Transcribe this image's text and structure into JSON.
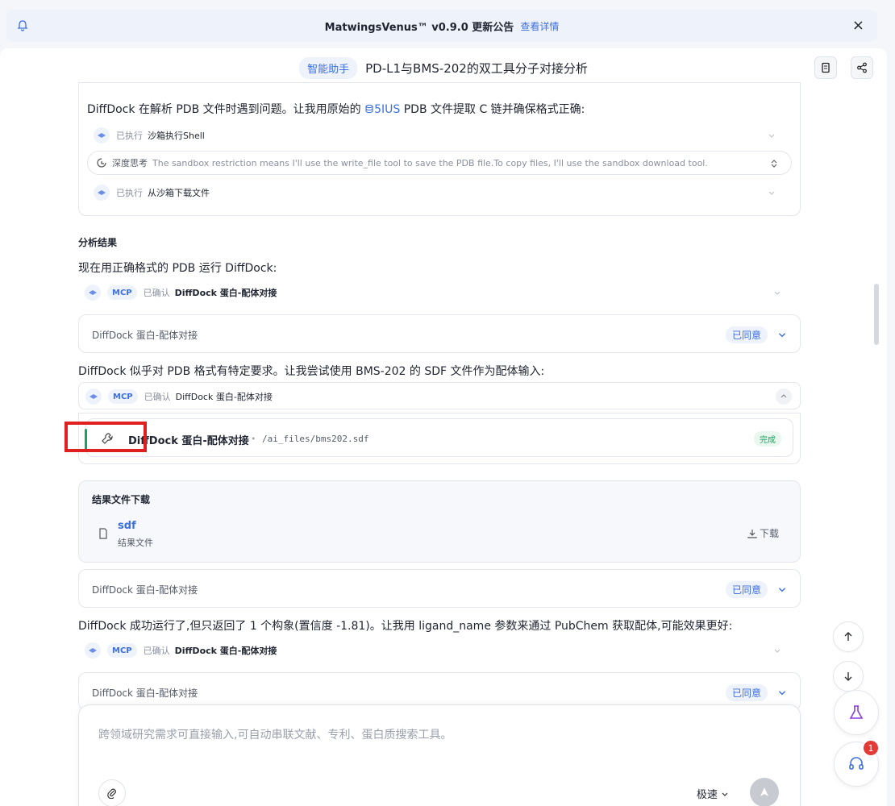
{
  "announcement": {
    "title": "MatwingsVenus™ v0.9.0 更新公告",
    "detail_link": "查看详情",
    "close": "×"
  },
  "header": {
    "tag": "智能助手",
    "title": "PD-L1与BMS-202的双工具分子对接分析"
  },
  "block1": {
    "text_prefix": "DiffDock 在解析 PDB 文件时遇到问题。让我用原始的 ",
    "pdb_link": "5IUS",
    "text_suffix": " PDB 文件提取 C 链并确保格式正确:",
    "steps": [
      {
        "status": "已执行",
        "name": "沙箱执行Shell"
      },
      {
        "status": "深度思考",
        "name": "The sandbox restriction means I'll use the write_file tool to save the PDB file.To copy files, I'll use the sandbox download tool."
      },
      {
        "status": "已执行",
        "name": "从沙箱下载文件"
      }
    ]
  },
  "analysis": {
    "heading": "分析结果",
    "text1": "现在用正确格式的 PDB 运行 DiffDock:",
    "mcp_label": "MCP",
    "confirmed": "已确认",
    "tool_name": "DiffDock 蛋白-配体对接",
    "approval_label": "DiffDock 蛋白-配体对接",
    "agreed": "已同意",
    "text2": "DiffDock 似乎对 PDB 格式有特定要求。让我尝试使用 BMS-202 的 SDF 文件作为配体输入:",
    "tool_call": {
      "name": "DiffDock 蛋白-配体对接",
      "path": "/ai_files/bms202.sdf",
      "status": "完成"
    },
    "download": {
      "heading": "结果文件下载",
      "file_name": "sdf",
      "file_desc": "结果文件",
      "download_label": "下载"
    },
    "text3": "DiffDock 成功运行了,但只返回了 1 个构象(置信度 -1.81)。让我用 ligand_name 参数来通过 PubChem 获取配体,可能效果更好:"
  },
  "composer": {
    "placeholder": "跨领域研究需求可直接输入,可自动串联文献、专利、蛋白质搜索工具。",
    "mode": "极速"
  },
  "support_badge": "1",
  "colors": {
    "accent": "#3d6fe0",
    "success": "#1aa260",
    "highlight": "#e02020"
  }
}
